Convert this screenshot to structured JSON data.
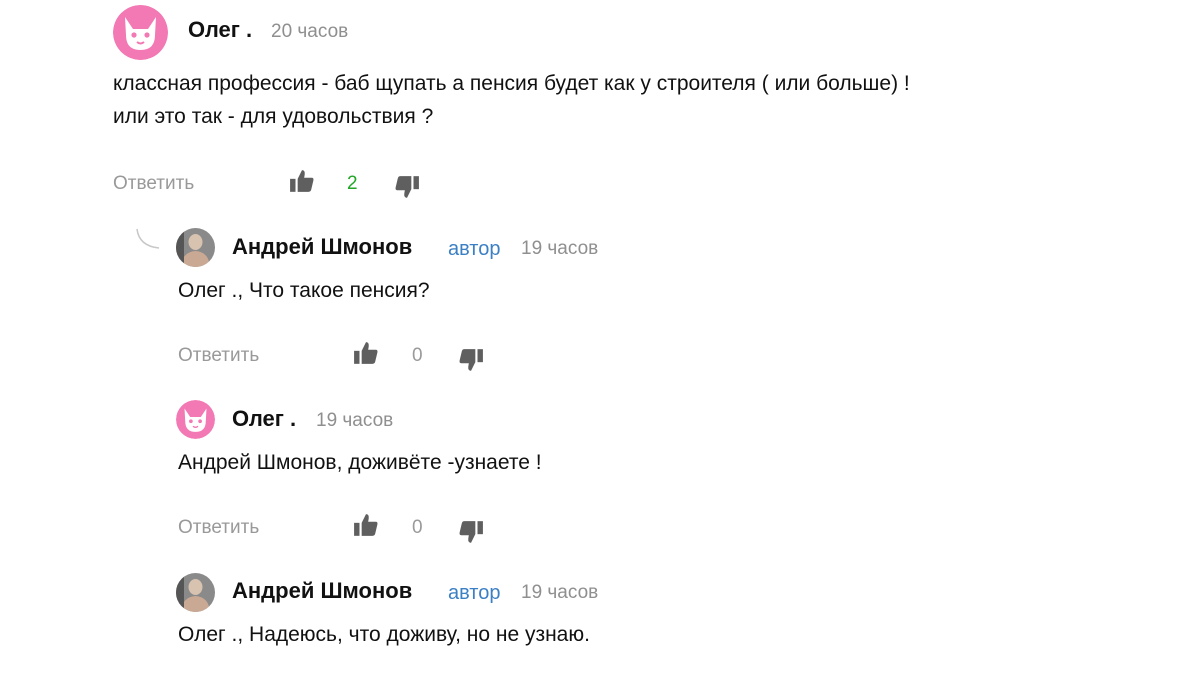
{
  "comments": [
    {
      "author": "Олег .",
      "time": "20 часов",
      "lines": [
        "классная профессия - баб щупать а пенсия будет как у строителя ( или больше) !",
        "или это так - для удовольствия ?"
      ],
      "reply_label": "Ответить",
      "likes": "2",
      "avatar": "pink-cat-avatar"
    },
    {
      "author": "Андрей Шмонов",
      "badge": "автор",
      "time": "19 часов",
      "lines": [
        "Олег ., Что такое пенсия?"
      ],
      "reply_label": "Ответить",
      "likes": "0",
      "avatar": "photo-avatar"
    },
    {
      "author": "Олег .",
      "time": "19 часов",
      "lines": [
        "Андрей Шмонов, доживёте -узнаете !"
      ],
      "reply_label": "Ответить",
      "likes": "0",
      "avatar": "pink-cat-avatar"
    },
    {
      "author": "Андрей Шмонов",
      "badge": "автор",
      "time": "19 часов",
      "lines": [
        "Олег ., Надеюсь, что доживу, но не узнаю."
      ],
      "avatar": "photo-avatar"
    }
  ],
  "colors": {
    "positive_likes": "#22a626",
    "author_badge": "#3b7fc4",
    "muted": "#999999",
    "cat_avatar": "#f279b4"
  },
  "icons": [
    "thumbs-up-icon",
    "thumbs-down-icon",
    "thread-connector-icon"
  ]
}
